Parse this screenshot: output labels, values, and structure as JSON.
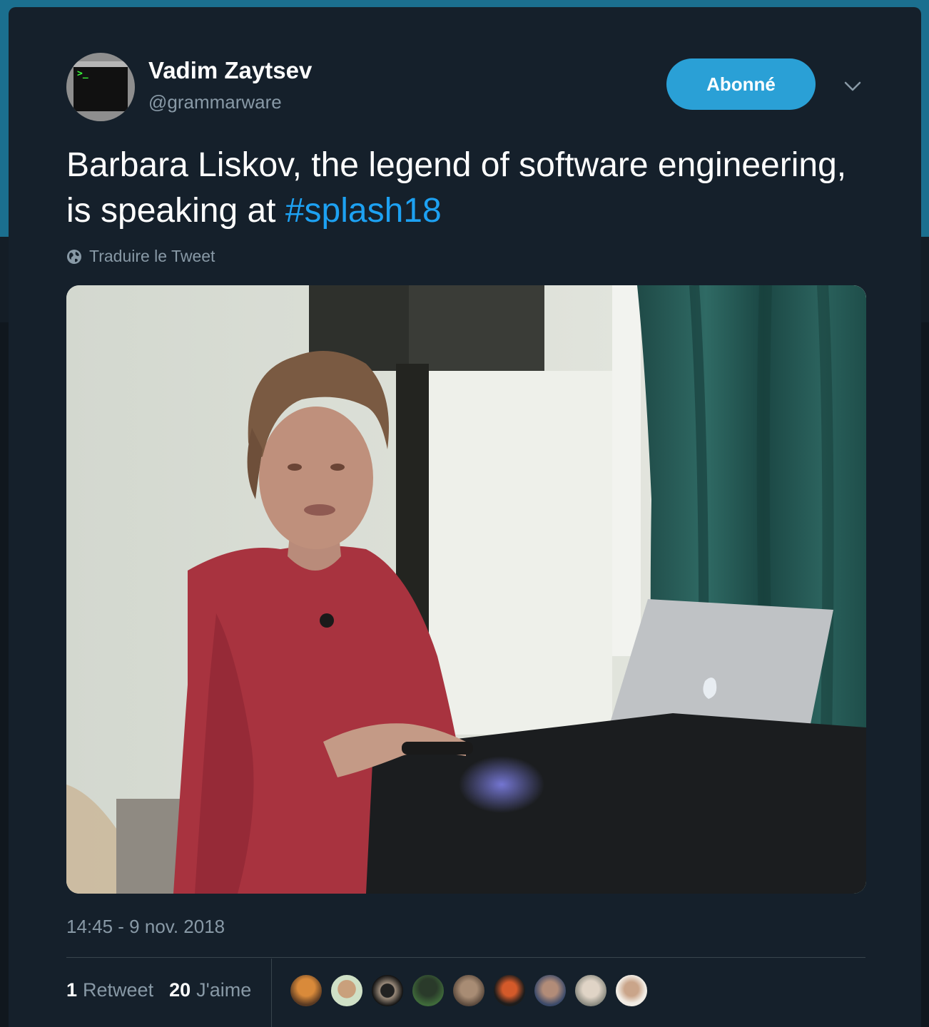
{
  "author": {
    "display_name": "Vadim Zaytsev",
    "handle": "@grammarware",
    "avatar_icon": "terminal-avatar-icon"
  },
  "follow_button": {
    "label": "Abonné",
    "color": "#2aa0d6"
  },
  "menu": {
    "icon": "chevron-down-icon"
  },
  "tweet": {
    "text_before": "Barbara Liskov, the legend of software engineering, is speaking at ",
    "hashtag": "#splash18",
    "hashtag_color": "#1da1f2"
  },
  "translate": {
    "label": "Traduire le Tweet",
    "icon": "globe-icon"
  },
  "media": {
    "type": "photo"
  },
  "timestamp": "14:45 - 9 nov. 2018",
  "stats": {
    "retweets": {
      "count": "1",
      "label": "Retweet"
    },
    "likes": {
      "count": "20",
      "label": "J'aime"
    }
  },
  "likers_count": 9,
  "colors": {
    "card_bg": "#15202b",
    "secondary_text": "#8899a6",
    "divider": "#38444d"
  }
}
